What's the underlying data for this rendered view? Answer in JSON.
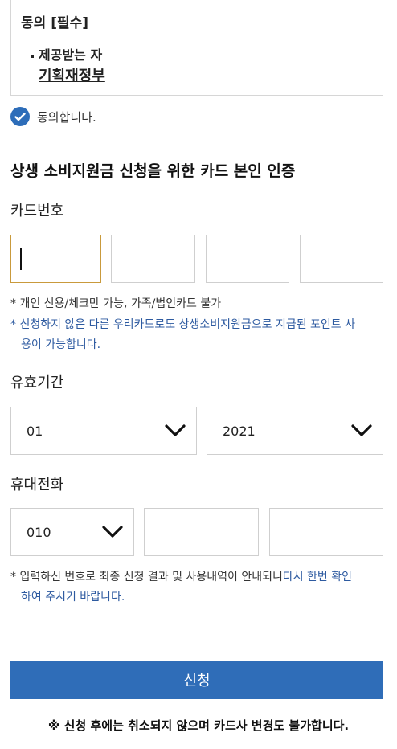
{
  "consent": {
    "title": "동의 [필수]",
    "recipient_label": "제공받는 자",
    "recipient_value": "기획재정부",
    "agree_text": "동의합니다."
  },
  "section_title": "상생 소비지원금 신청을 위한 카드 본인 인증",
  "card": {
    "label": "카드번호",
    "note_1": "* 개인 신용/체크만 가능, 가족/법인카드 불가",
    "note_2_line1": "* 신청하지 않은 다른 우리카드로도 상생소비지원금으로 지급된 포인트 사",
    "note_2_line2": "용이 가능합니다."
  },
  "expiry": {
    "label": "유효기간",
    "month": "01",
    "year": "2021"
  },
  "phone": {
    "label": "휴대전화",
    "prefix": "010",
    "note_line1_gray": "* 입력하신 번호로 최종 신청 결과 및 사용내역이 안내되니",
    "note_line1_blue": "다시 한번 확인",
    "note_line2": "하여 주시기 바랍니다."
  },
  "submit_label": "신청",
  "final_notice": "※ 신청 후에는 취소되지 않으며 카드사 변경도 불가합니다.",
  "colors": {
    "accent": "#2f6db8",
    "focus_border": "#c99a3c",
    "note_blue": "#2d5aa0"
  }
}
